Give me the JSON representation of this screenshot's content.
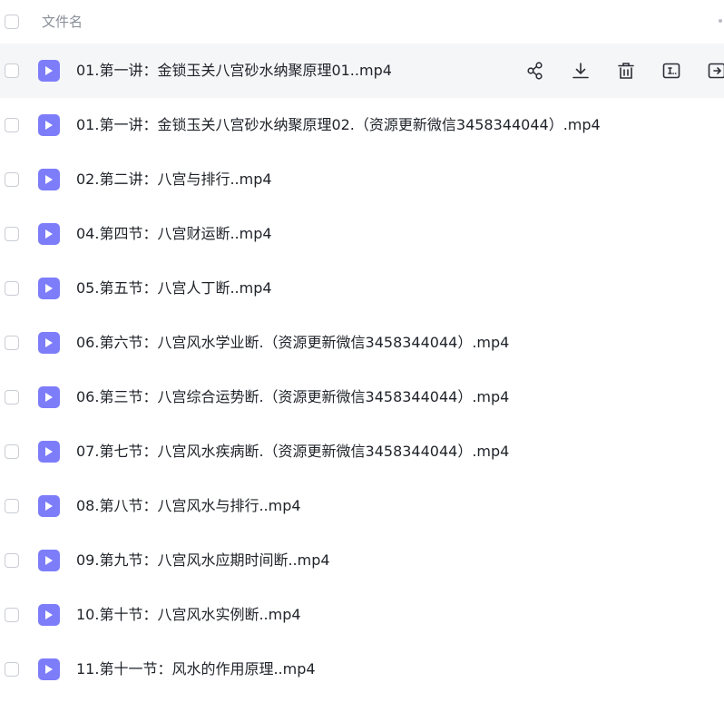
{
  "header": {
    "title": "文件名"
  },
  "files": [
    {
      "name": "01.第一讲：金锁玉关八宫砂水纳聚原理01..mp4"
    },
    {
      "name": "01.第一讲：金锁玉关八宫砂水纳聚原理02.（资源更新微信3458344044）.mp4"
    },
    {
      "name": "02.第二讲：八宫与排行..mp4"
    },
    {
      "name": "04.第四节：八宫财运断..mp4"
    },
    {
      "name": "05.第五节：八宫人丁断..mp4"
    },
    {
      "name": "06.第六节：八宫风水学业断.（资源更新微信3458344044）.mp4"
    },
    {
      "name": "06.第三节：八宫综合运势断.（资源更新微信3458344044）.mp4"
    },
    {
      "name": "07.第七节：八宫风水疾病断.（资源更新微信3458344044）.mp4"
    },
    {
      "name": "08.第八节：八宫风水与排行..mp4"
    },
    {
      "name": "09.第九节：八宫风水应期时间断..mp4"
    },
    {
      "name": "10.第十节：八宫风水实例断..mp4"
    },
    {
      "name": "11.第十一节：风水的作用原理..mp4"
    }
  ],
  "row_actions": [
    "share-icon",
    "download-icon",
    "delete-icon",
    "rename-icon",
    "more-icon"
  ],
  "colors": {
    "file_icon": "#7d7dfa",
    "hover_row": "#f5f6f8",
    "text": "#1f2329",
    "muted": "#8a8f99"
  }
}
